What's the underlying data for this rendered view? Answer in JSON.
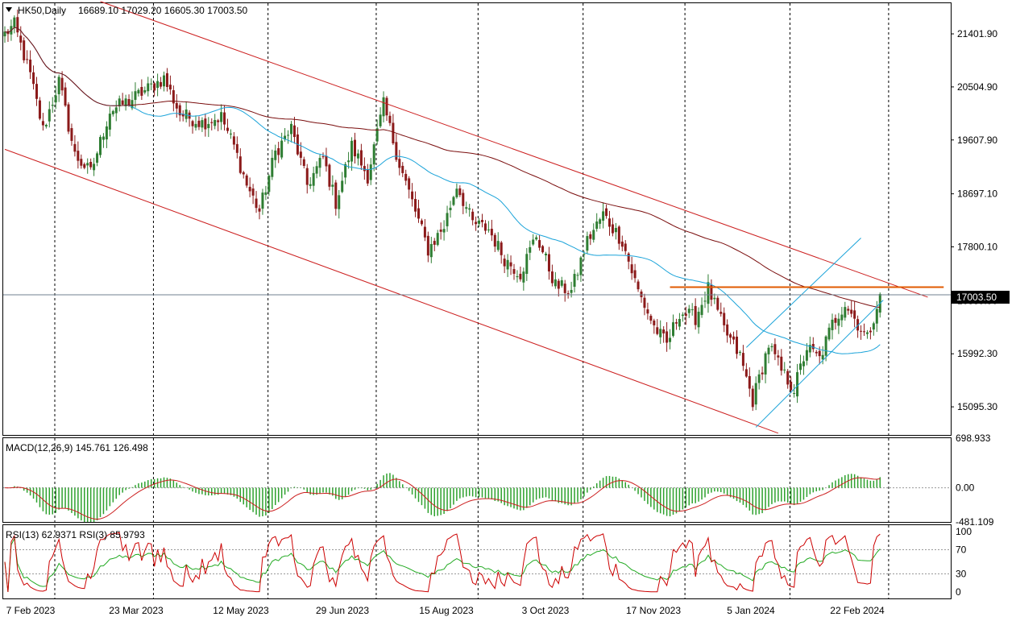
{
  "symbol_header": "HK50,Daily",
  "ohlc_header": "16689.10 17029.20 16605.30 17003.50",
  "macd_label": "MACD(12,26,9) 145.761 126.498",
  "rsi_label": "RSI(13) 62.9371 RSI(3) 85.9793",
  "chart_data": {
    "type": "candlestick",
    "price_axis_ticks": [
      "21401.90",
      "20504.90",
      "19607.90",
      "18697.10",
      "17800.10",
      "16889.50",
      "15992.30",
      "15095.30"
    ],
    "price_ylim": [
      14620,
      21920
    ],
    "current_price": "17003.50",
    "x_tick_labels": [
      "7 Feb 2023",
      "23 Mar 2023",
      "12 May 2023",
      "29 Jun 2023",
      "15 Aug 2023",
      "3 Oct 2023",
      "17 Nov 2023",
      "5 Jan 2024",
      "22 Feb 2024"
    ],
    "macd_axis_ticks": [
      "698.933",
      "0.00",
      "-481.109"
    ],
    "macd_ylim": [
      -481.109,
      698.933
    ],
    "rsi_axis_ticks": [
      "100",
      "70",
      "30",
      "0"
    ],
    "rsi_levels": [
      70,
      30
    ],
    "colors": {
      "bull": "#2e7d32",
      "bear": "#8b1a1a",
      "channel": "#cc1f1f",
      "ma_fast": "#1aa3d9",
      "ma_slow": "#7a0d0d",
      "resistance": "#e05a00",
      "macd_hist": "#2ea12e",
      "macd_signal": "#cc1f1f",
      "rsi_fast": "#cc0000",
      "rsi_slow": "#22aa22"
    },
    "anchors": [
      {
        "i": 0,
        "v": 21400
      },
      {
        "i": 3,
        "v": 21550
      },
      {
        "i": 8,
        "v": 20700
      },
      {
        "i": 12,
        "v": 19780
      },
      {
        "i": 17,
        "v": 20600
      },
      {
        "i": 22,
        "v": 19350
      },
      {
        "i": 27,
        "v": 19050
      },
      {
        "i": 33,
        "v": 20100
      },
      {
        "i": 40,
        "v": 20300
      },
      {
        "i": 50,
        "v": 20650
      },
      {
        "i": 55,
        "v": 20050
      },
      {
        "i": 62,
        "v": 19900
      },
      {
        "i": 68,
        "v": 20000
      },
      {
        "i": 72,
        "v": 19500
      },
      {
        "i": 76,
        "v": 18850
      },
      {
        "i": 80,
        "v": 18400
      },
      {
        "i": 85,
        "v": 19400
      },
      {
        "i": 90,
        "v": 19800
      },
      {
        "i": 95,
        "v": 18850
      },
      {
        "i": 100,
        "v": 19300
      },
      {
        "i": 104,
        "v": 18550
      },
      {
        "i": 109,
        "v": 19500
      },
      {
        "i": 114,
        "v": 19000
      },
      {
        "i": 119,
        "v": 20200
      },
      {
        "i": 124,
        "v": 19200
      },
      {
        "i": 129,
        "v": 18400
      },
      {
        "i": 133,
        "v": 17750
      },
      {
        "i": 138,
        "v": 18150
      },
      {
        "i": 142,
        "v": 18850
      },
      {
        "i": 147,
        "v": 18200
      },
      {
        "i": 152,
        "v": 18100
      },
      {
        "i": 157,
        "v": 17600
      },
      {
        "i": 162,
        "v": 17350
      },
      {
        "i": 167,
        "v": 18000
      },
      {
        "i": 173,
        "v": 17150
      },
      {
        "i": 178,
        "v": 17050
      },
      {
        "i": 183,
        "v": 17900
      },
      {
        "i": 188,
        "v": 18350
      },
      {
        "i": 194,
        "v": 17900
      },
      {
        "i": 199,
        "v": 17050
      },
      {
        "i": 204,
        "v": 16450
      },
      {
        "i": 208,
        "v": 16150
      },
      {
        "i": 212,
        "v": 16700
      },
      {
        "i": 217,
        "v": 16600
      },
      {
        "i": 221,
        "v": 17100
      },
      {
        "i": 226,
        "v": 16400
      },
      {
        "i": 231,
        "v": 15950
      },
      {
        "i": 235,
        "v": 15200
      },
      {
        "i": 240,
        "v": 16150
      },
      {
        "i": 244,
        "v": 15700
      },
      {
        "i": 248,
        "v": 15400
      },
      {
        "i": 252,
        "v": 16100
      },
      {
        "i": 256,
        "v": 15900
      },
      {
        "i": 260,
        "v": 16500
      },
      {
        "i": 264,
        "v": 16850
      },
      {
        "i": 268,
        "v": 16500
      },
      {
        "i": 271,
        "v": 16250
      },
      {
        "i": 275,
        "v": 17003.5
      }
    ],
    "drawn_lines": [
      {
        "name": "channel-upper",
        "i1": 30,
        "v1": 21950,
        "i2": 290,
        "v2": 16950
      },
      {
        "name": "channel-lower",
        "i1": 0,
        "v1": 19450,
        "i2": 243,
        "v2": 14650
      },
      {
        "name": "uptrend-lower",
        "i1": 236,
        "v1": 14750,
        "i2": 276,
        "v2": 16900
      },
      {
        "name": "uptrend-upper",
        "i1": 233,
        "v1": 16100,
        "i2": 269,
        "v2": 17950
      },
      {
        "name": "resistance",
        "i1": 209,
        "v1": 17120,
        "i2": 295,
        "v2": 17120
      }
    ]
  }
}
